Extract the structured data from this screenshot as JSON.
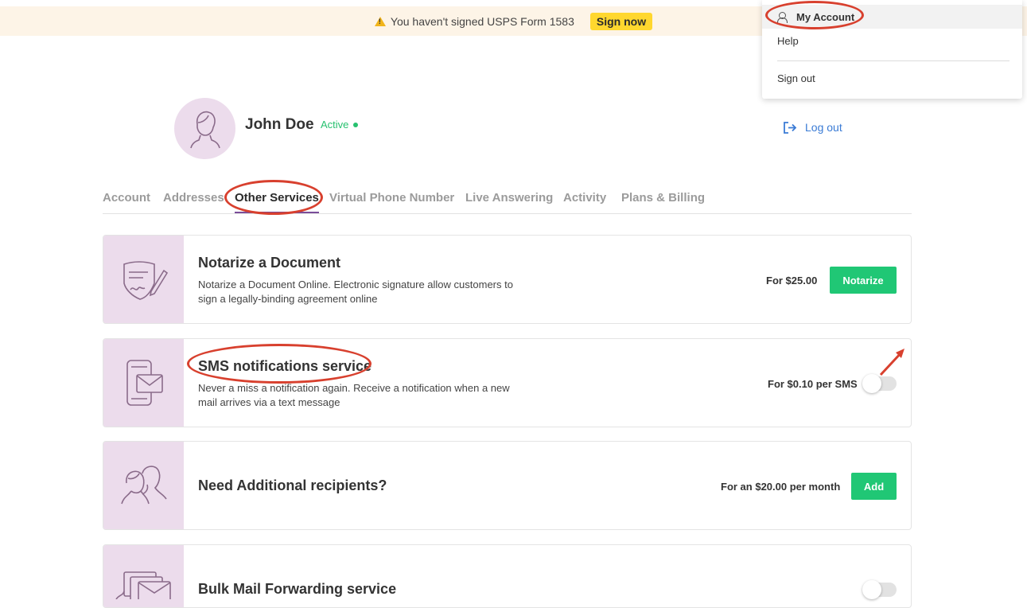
{
  "banner": {
    "message": "You haven't signed USPS Form 1583",
    "cta": "Sign now",
    "icon": "warning-icon"
  },
  "dropdown": {
    "items": [
      {
        "label": "My Account",
        "icon": "user-icon"
      },
      {
        "label": "Help"
      },
      {
        "label": "Sign out"
      }
    ]
  },
  "profile": {
    "name": "John Doe",
    "status": "Active",
    "logout_label": "Log out"
  },
  "tabs": [
    {
      "label": "Account"
    },
    {
      "label": "Addresses"
    },
    {
      "label": "Other Services",
      "active": true
    },
    {
      "label": "Virtual Phone Number"
    },
    {
      "label": "Live Answering"
    },
    {
      "label": "Activity"
    },
    {
      "label": "Plans & Billing"
    }
  ],
  "services": [
    {
      "title": "Notarize a Document",
      "description": "Notarize a Document Online. Electronic signature allow customers to sign a legally-binding agreement online",
      "price": "For $25.00",
      "button": "Notarize",
      "icon": "document-sign-icon"
    },
    {
      "title": "SMS notifications service",
      "description": "Never a miss a notification again. Receive a notification when a new mail arrives via a text message",
      "price": "For $0.10 per SMS",
      "toggle_on": false,
      "icon": "phone-mail-icon"
    },
    {
      "title": "Need Additional recipients?",
      "price": "For an $20.00 per month",
      "button": "Add",
      "icon": "people-icon"
    },
    {
      "title": "Bulk Mail Forwarding service",
      "toggle_on": false,
      "icon": "envelopes-icon"
    }
  ],
  "colors": {
    "accent_green": "#20c775",
    "status_green": "#27c16f",
    "link_blue": "#3a7bd5",
    "thumb_bg": "#ecdcec",
    "banner_bg": "#fdf4e7",
    "annotation_red": "#d8402e"
  }
}
